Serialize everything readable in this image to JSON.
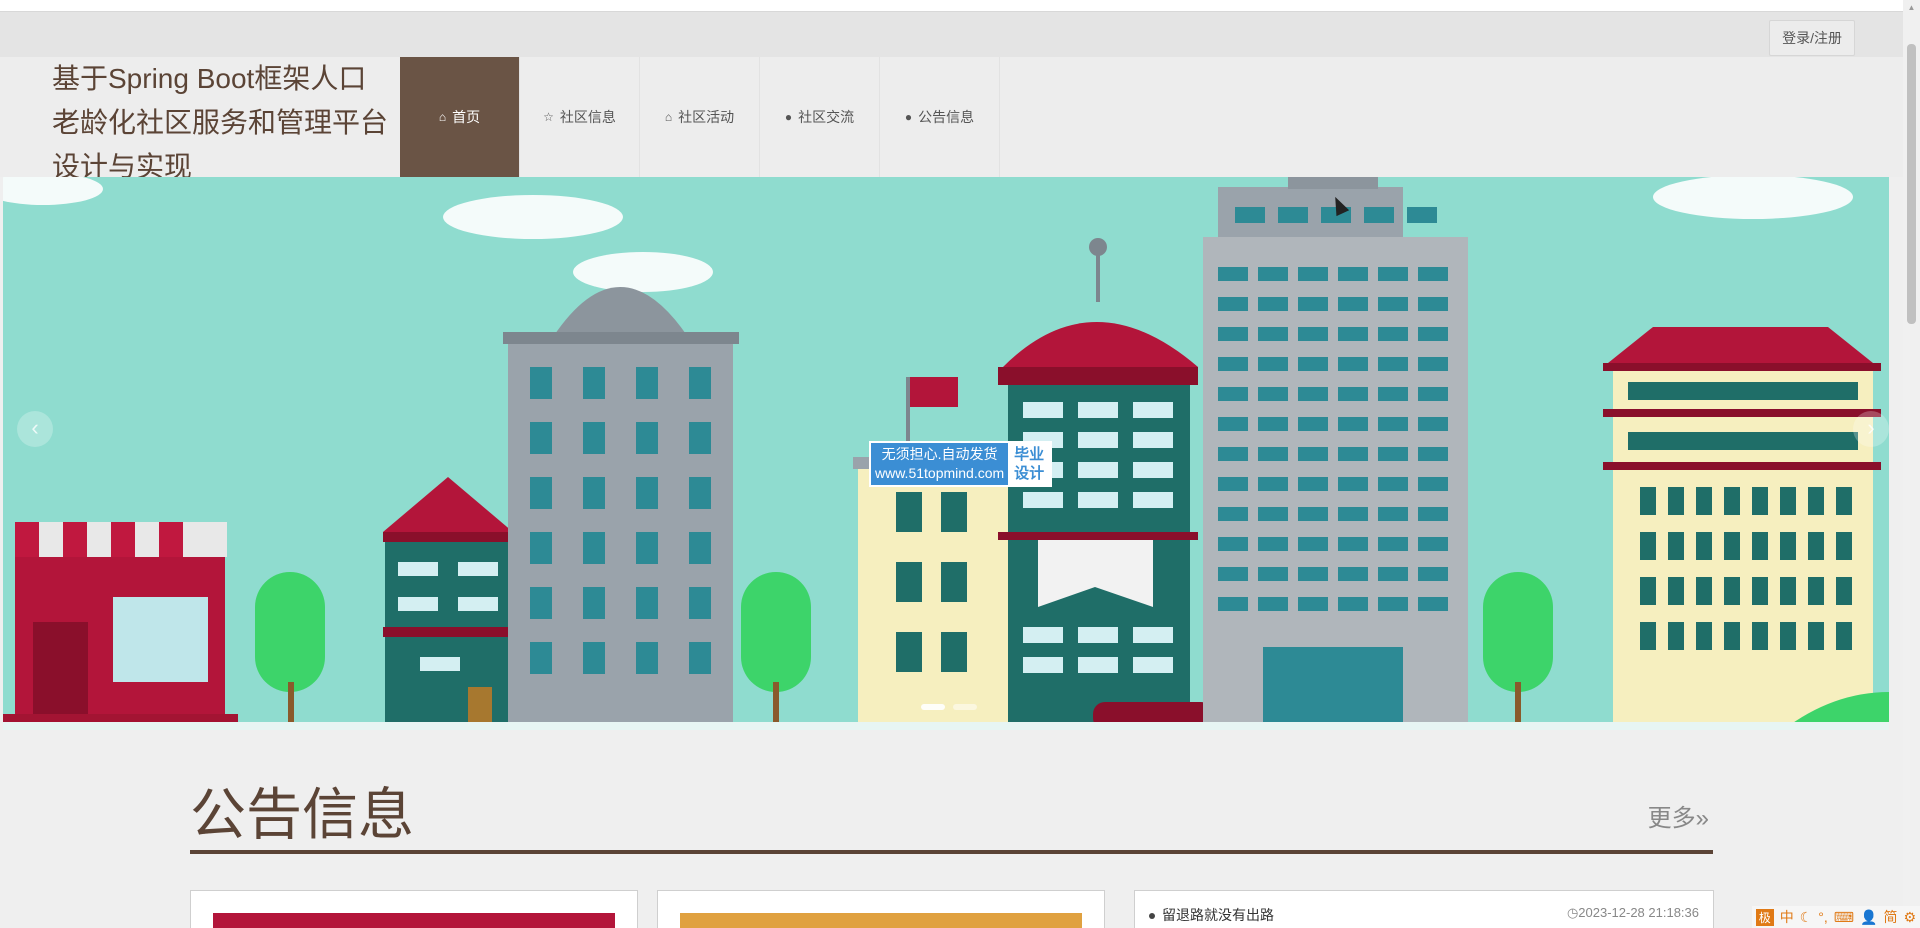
{
  "header": {
    "login_label": "登录/注册",
    "site_title": "基于Spring Boot框架人口老龄化社区服务和管理平台设计与实现"
  },
  "nav": {
    "items": [
      {
        "label": "首页",
        "icon": "home-icon",
        "active": true
      },
      {
        "label": "社区信息",
        "icon": "star-icon",
        "active": false
      },
      {
        "label": "社区活动",
        "icon": "bag-icon",
        "active": false
      },
      {
        "label": "社区交流",
        "icon": "exclamation-circle-icon",
        "active": false
      },
      {
        "label": "公告信息",
        "icon": "question-circle-icon",
        "active": false
      }
    ]
  },
  "banner": {
    "watermark_line1": "无须担心.自动发货",
    "watermark_line2": "www.51topmind.com",
    "watermark_badge_line1": "毕业",
    "watermark_badge_line2": "设计",
    "prev_icon": "chevron-left-icon",
    "next_icon": "chevron-right-icon",
    "dots_count": 2
  },
  "notice_section": {
    "title": "公告信息",
    "more_label": "更多»",
    "list": [
      {
        "title": "留退路就没有出路",
        "date": "2023-12-28 21:18:36"
      }
    ]
  },
  "ime_bar": {
    "items": [
      "极",
      "中",
      "☾",
      "°,",
      "⌨",
      "👤",
      "简",
      "⚙"
    ]
  },
  "colors": {
    "brand": "#5b4436",
    "nav_active": "#6a5445",
    "banner_sky": "#8fdccf"
  }
}
